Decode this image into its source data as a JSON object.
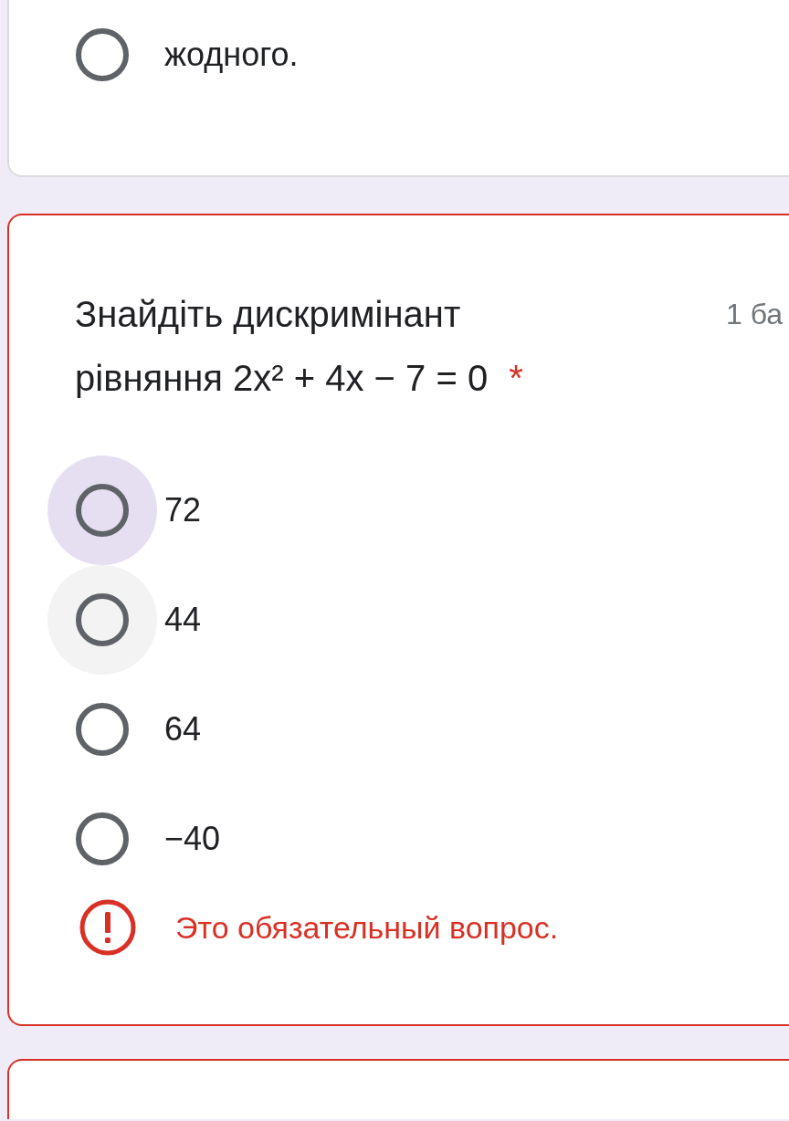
{
  "previous_question": {
    "options": [
      {
        "label": "жодного.",
        "selected": false
      }
    ]
  },
  "question": {
    "title": "Знайдіть дискримінант рівняння 2x² + 4x − 7 = 0",
    "required_mark": "*",
    "points": "1 ба",
    "error": true,
    "options": [
      {
        "label": "72",
        "selected": false,
        "focused": true,
        "hovered": false
      },
      {
        "label": "44",
        "selected": false,
        "focused": false,
        "hovered": true
      },
      {
        "label": "64",
        "selected": false,
        "focused": false,
        "hovered": false
      },
      {
        "label": "−40",
        "selected": false,
        "focused": false,
        "hovered": false
      }
    ],
    "error_message": "Это обязательный вопрос."
  },
  "next_question": {
    "error": true
  }
}
